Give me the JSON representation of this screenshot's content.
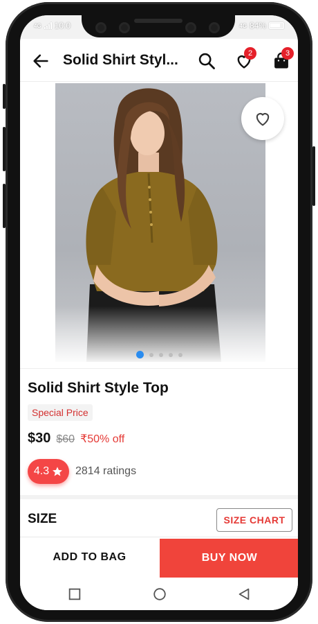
{
  "status_bar": {
    "time": "10:0",
    "network_left": "4G",
    "network_right": "4G",
    "battery": "84%"
  },
  "app_bar": {
    "title": "Solid Shirt Styl...",
    "wishlist_count": "2",
    "bag_count": "3"
  },
  "gallery": {
    "slide_count": 5,
    "active_slide": 1
  },
  "product": {
    "name": "Solid Shirt Style Top",
    "tag": "Special Price",
    "price": "$30",
    "mrp": "$60",
    "discount": "₹50% off",
    "rating": "4.3",
    "ratings_count": "2814 ratings"
  },
  "size": {
    "label": "SIZE",
    "chart_button": "SIZE CHART"
  },
  "actions": {
    "add_to_bag": "ADD TO BAG",
    "buy_now": "BUY NOW"
  },
  "colors": {
    "accent": "#f0443b",
    "badge": "#e5202a",
    "rating_pill": "#f44646",
    "dot_active": "#2a8cef"
  }
}
